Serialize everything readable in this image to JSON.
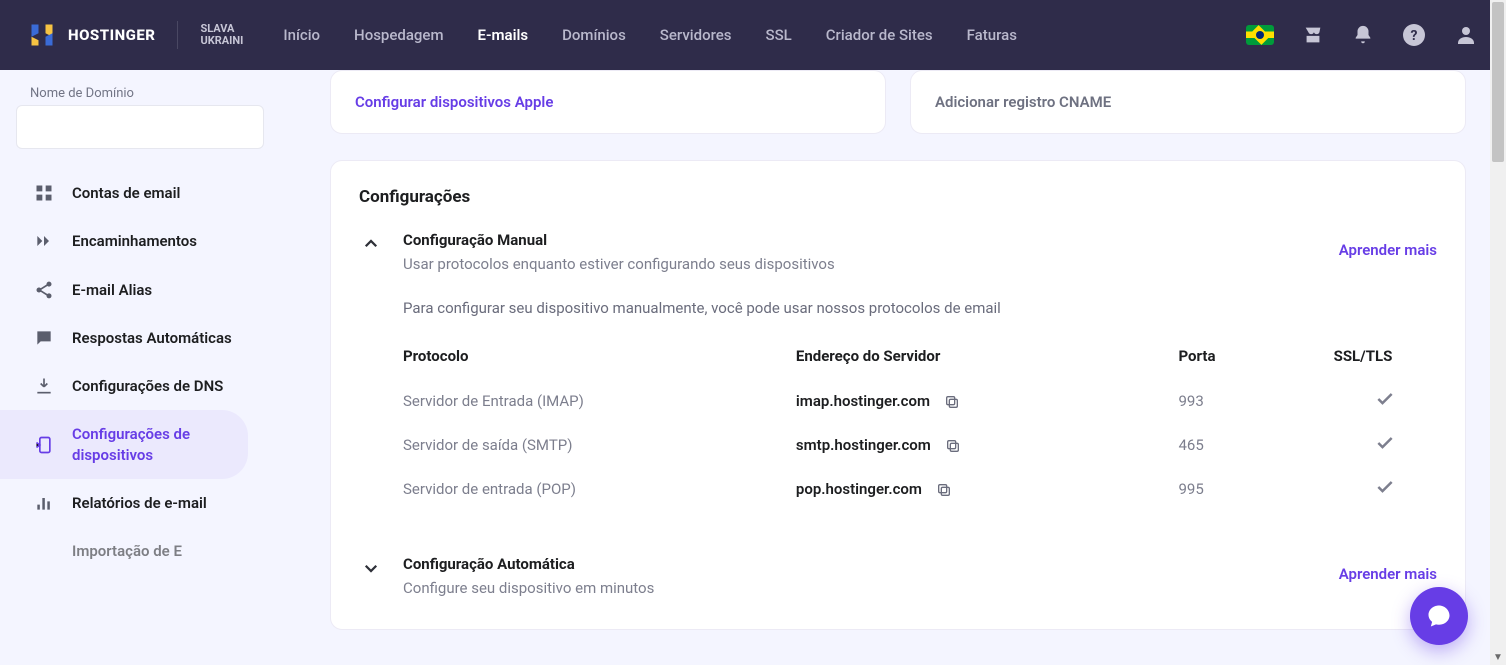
{
  "brand": {
    "name": "HOSTINGER",
    "slava_line1": "SLAVA",
    "slava_line2": "UKRAINI"
  },
  "nav": {
    "inicio": "Início",
    "hospedagem": "Hospedagem",
    "emails": "E-mails",
    "dominios": "Domínios",
    "servidores": "Servidores",
    "ssl": "SSL",
    "criador": "Criador de Sites",
    "faturas": "Faturas"
  },
  "sidebar": {
    "domain_label": "Nome de Domínio",
    "items": {
      "contas": "Contas de email",
      "encaminhamentos": "Encaminhamentos",
      "alias": "E-mail Alias",
      "respostas": "Respostas Automáticas",
      "dns": "Configurações de DNS",
      "dispositivos": "Configurações de dispositivos",
      "relatorios": "Relatórios de e-mail",
      "importacao": "Importação de E"
    }
  },
  "quickcards": {
    "apple": "Configurar dispositivos Apple",
    "cname": "Adicionar registro CNAME"
  },
  "panel": {
    "heading": "Configurações",
    "manual": {
      "title": "Configuração Manual",
      "sub": "Usar protocolos enquanto estiver configurando seus dispositivos",
      "learn": "Aprender mais",
      "intro": "Para configurar seu dispositivo manualmente, você pode usar nossos protocolos de email",
      "cols": {
        "proto": "Protocolo",
        "addr": "Endereço do Servidor",
        "port": "Porta",
        "ssl": "SSL/TLS"
      },
      "rows": [
        {
          "proto": "Servidor de Entrada (IMAP)",
          "addr": "imap.hostinger.com",
          "port": "993"
        },
        {
          "proto": "Servidor de saída (SMTP)",
          "addr": "smtp.hostinger.com",
          "port": "465"
        },
        {
          "proto": "Servidor de entrada (POP)",
          "addr": "pop.hostinger.com",
          "port": "995"
        }
      ]
    },
    "auto": {
      "title": "Configuração Automática",
      "sub": "Configure seu dispositivo em minutos",
      "learn": "Aprender mais"
    }
  }
}
